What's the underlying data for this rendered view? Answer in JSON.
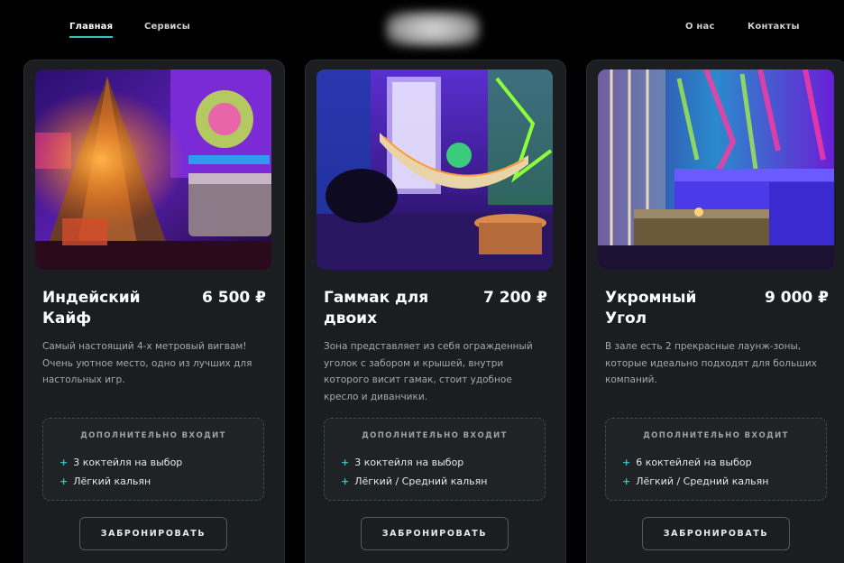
{
  "nav": {
    "home": "Главная",
    "services": "Сервисы",
    "about": "О нас",
    "contacts": "Контакты"
  },
  "colors": {
    "accent": "#2ec4c4",
    "card_bg": "#1b1d20",
    "page_bg": "#000000"
  },
  "cards": [
    {
      "title": "Индейский Кайф",
      "price": "6 500 ₽",
      "description": "Самый настоящий 4-х метровый вигвам! Очень уютное место, одно из лучших для настольных игр.",
      "extras_title": "ДОПОЛНИТЕЛЬНО ВХОДИТ",
      "extras": [
        "3 коктейля на выбор",
        "Лёгкий кальян"
      ],
      "button": "ЗАБРОНИРОВАТЬ"
    },
    {
      "title": "Гаммак для двоих",
      "price": "7 200 ₽",
      "description": "Зона представляет из себя огражденный уголок с забором и крышей, внутри которого висит гамак, стоит удобное кресло и диванчики.",
      "extras_title": "ДОПОЛНИТЕЛЬНО ВХОДИТ",
      "extras": [
        "3 коктейля на выбор",
        "Лёгкий / Средний кальян"
      ],
      "button": "ЗАБРОНИРОВАТЬ"
    },
    {
      "title": "Укромный Угол",
      "price": "9 000 ₽",
      "description": "В зале есть 2 прекрасные лаунж-зоны, которые идеально подходят для больших компаний.",
      "extras_title": "ДОПОЛНИТЕЛЬНО ВХОДИТ",
      "extras": [
        "6 коктейлей на выбор",
        "Лёгкий / Средний кальян"
      ],
      "button": "ЗАБРОНИРОВАТЬ"
    }
  ]
}
